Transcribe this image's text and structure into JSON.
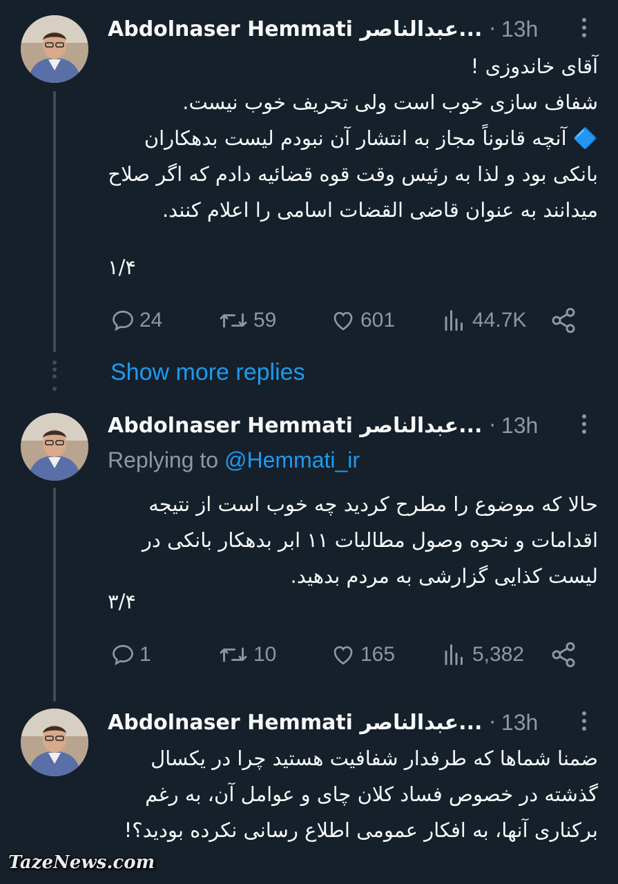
{
  "tweets": [
    {
      "author_name": "Abdolnaser Hemmati عبدالناصر...",
      "separator": "·",
      "time": "13h",
      "text": "آقای خاندوزی !\nشفاف سازی خوب است ولی تحریف خوب نیست.\n🔷 آنچه قانوناً مجاز به انتشار آن نبودم لیست بدهکاران بانکی بود و لذا به رئیس وقت قوه قضائیه دادم که اگر صلاح میدانند به عنوان قاضی القضات اسامی را اعلام کنند.",
      "counter": "۱/۴",
      "replies": "24",
      "retweets": "59",
      "likes": "601",
      "views": "44.7K"
    },
    {
      "author_name": "Abdolnaser Hemmati عبدالناصر...",
      "separator": "·",
      "time": "13h",
      "replying_label": "Replying to",
      "replying_handle": "@Hemmati_ir",
      "text": "حالا که موضوع را مطرح کردید چه خوب است از نتیجه اقدامات و نحوه وصول مطالبات ۱۱ ابر بدهکار بانکی در لیست کذایی گزارشی به مردم بدهید.",
      "counter": "۳/۴",
      "replies": "1",
      "retweets": "10",
      "likes": "165",
      "views": "5,382"
    },
    {
      "author_name": "Abdolnaser Hemmati عبدالناصر...",
      "separator": "·",
      "time": "13h",
      "text": "ضمنا شماها که طرفدار شفافیت هستید چرا در یکسال گذشته در خصوص فساد کلان چای و عوامل آن، به رغم برکناری آنها، به افکار عمومی اطلاع رسانی نکرده بودید؟!"
    }
  ],
  "show_more_replies": "Show more replies",
  "watermark": "TazeNews.com",
  "icons": {
    "reply": "reply-icon",
    "retweet": "retweet-icon",
    "like": "heart-icon",
    "views": "views-icon",
    "share": "share-icon",
    "more": "more-icon"
  },
  "colors": {
    "background": "#15202b",
    "text": "#f7f9f9",
    "muted": "#8b98a5",
    "link": "#1d9bf0",
    "thread_line": "#3d4c5b"
  }
}
